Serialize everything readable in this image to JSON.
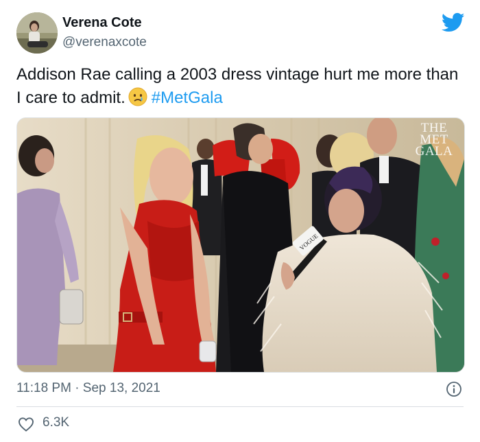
{
  "author": {
    "display_name": "Verena Cote",
    "handle": "@verenaxcote",
    "avatar_icon": "profile-photo"
  },
  "brand": {
    "logo_icon": "twitter-bird-icon",
    "color": "#1d9bf0"
  },
  "tweet": {
    "text": "Addison Rae calling a 2003 dress vintage hurt me more than I care to admit.",
    "emoji": "crying-face-emoji",
    "hashtag": "#MetGala"
  },
  "media": {
    "watermark": "THE\nMET\nGALA",
    "mic_flag": "VOGUE"
  },
  "meta": {
    "timestamp": "11:18 PM · Sep 13, 2021",
    "likes": "6.3K"
  },
  "colors": {
    "text_primary": "#0f1419",
    "text_secondary": "#536471",
    "link": "#1d9bf0"
  }
}
